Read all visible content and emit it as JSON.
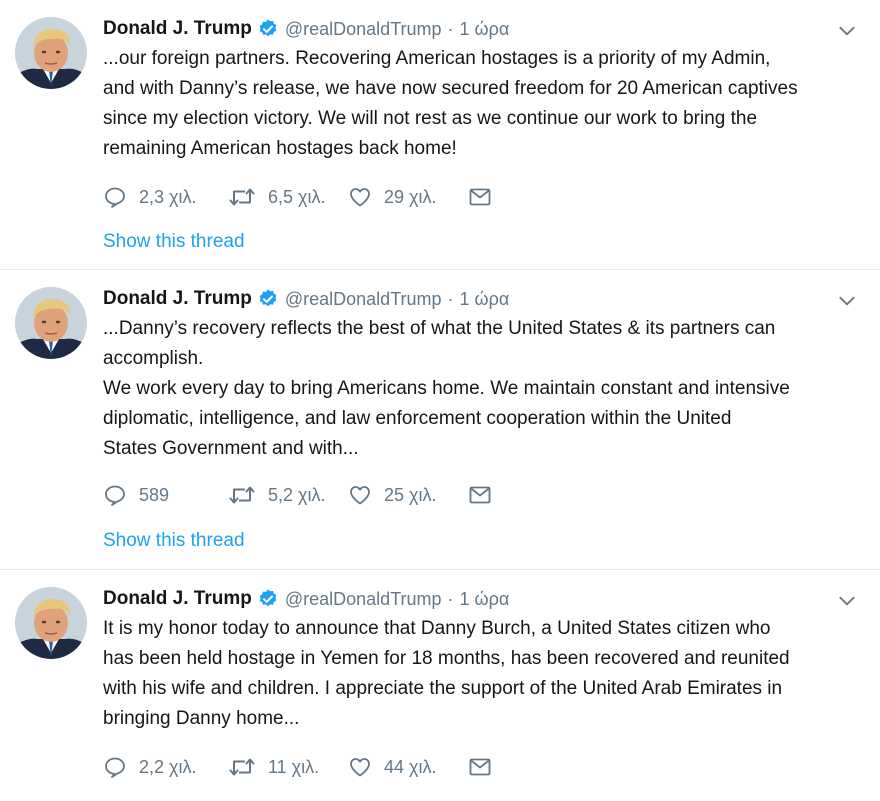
{
  "tweets": [
    {
      "author": "Donald J. Trump",
      "handle": "@realDonaldTrump",
      "separator": "·",
      "time": "1 ώρα",
      "lines": [
        "...our foreign partners. Recovering American hostages is a priority of my Admin,",
        "and with Danny’s release, we have now secured freedom for 20 American captives",
        "since my election victory. We will not rest as we continue our work to bring the",
        "remaining American hostages back home!"
      ],
      "replies": "2,3 χιλ.",
      "retweets": "6,5 χιλ.",
      "likes": "29 χιλ.",
      "show_thread": "Show this thread"
    },
    {
      "author": "Donald J. Trump",
      "handle": "@realDonaldTrump",
      "separator": "·",
      "time": "1 ώρα",
      "lines": [
        "...Danny’s recovery reflects the best of what the United States & its partners can",
        "accomplish.",
        "We work every day to bring Americans home. We maintain constant and intensive",
        "diplomatic, intelligence, and law enforcement cooperation within the United",
        "States Government and with..."
      ],
      "replies": "589",
      "retweets": "5,2 χιλ.",
      "likes": "25 χιλ.",
      "show_thread": "Show this thread"
    },
    {
      "author": "Donald J. Trump",
      "handle": "@realDonaldTrump",
      "separator": "·",
      "time": "1 ώρα",
      "lines": [
        "It is my honor today to announce that Danny Burch, a United States citizen who",
        "has been held hostage in Yemen for 18 months, has been recovered and reunited",
        "with his wife and children. I appreciate the support of the United Arab Emirates in",
        "bringing Danny home..."
      ],
      "replies": "2,2 χιλ.",
      "retweets": "11 χιλ.",
      "likes": "44 χιλ."
    }
  ],
  "icons": {
    "reply": "reply-icon",
    "retweet": "retweet-icon",
    "like": "heart-icon",
    "message": "envelope-icon",
    "verified": "verified-badge-icon",
    "caret": "chevron-down-icon"
  },
  "colors": {
    "link": "#1da1f2",
    "secondary_text": "#657786",
    "primary_text": "#14171a",
    "verified": "#1da1f2",
    "divider": "#e6ecf0"
  }
}
